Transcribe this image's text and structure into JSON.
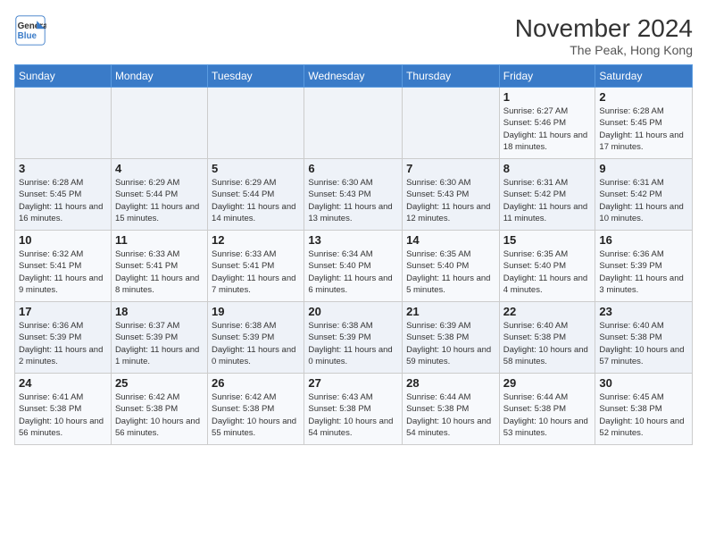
{
  "header": {
    "logo_line1": "General",
    "logo_line2": "Blue",
    "month": "November 2024",
    "location": "The Peak, Hong Kong"
  },
  "weekdays": [
    "Sunday",
    "Monday",
    "Tuesday",
    "Wednesday",
    "Thursday",
    "Friday",
    "Saturday"
  ],
  "weeks": [
    [
      {
        "day": "",
        "info": ""
      },
      {
        "day": "",
        "info": ""
      },
      {
        "day": "",
        "info": ""
      },
      {
        "day": "",
        "info": ""
      },
      {
        "day": "",
        "info": ""
      },
      {
        "day": "1",
        "info": "Sunrise: 6:27 AM\nSunset: 5:46 PM\nDaylight: 11 hours and 18 minutes."
      },
      {
        "day": "2",
        "info": "Sunrise: 6:28 AM\nSunset: 5:45 PM\nDaylight: 11 hours and 17 minutes."
      }
    ],
    [
      {
        "day": "3",
        "info": "Sunrise: 6:28 AM\nSunset: 5:45 PM\nDaylight: 11 hours and 16 minutes."
      },
      {
        "day": "4",
        "info": "Sunrise: 6:29 AM\nSunset: 5:44 PM\nDaylight: 11 hours and 15 minutes."
      },
      {
        "day": "5",
        "info": "Sunrise: 6:29 AM\nSunset: 5:44 PM\nDaylight: 11 hours and 14 minutes."
      },
      {
        "day": "6",
        "info": "Sunrise: 6:30 AM\nSunset: 5:43 PM\nDaylight: 11 hours and 13 minutes."
      },
      {
        "day": "7",
        "info": "Sunrise: 6:30 AM\nSunset: 5:43 PM\nDaylight: 11 hours and 12 minutes."
      },
      {
        "day": "8",
        "info": "Sunrise: 6:31 AM\nSunset: 5:42 PM\nDaylight: 11 hours and 11 minutes."
      },
      {
        "day": "9",
        "info": "Sunrise: 6:31 AM\nSunset: 5:42 PM\nDaylight: 11 hours and 10 minutes."
      }
    ],
    [
      {
        "day": "10",
        "info": "Sunrise: 6:32 AM\nSunset: 5:41 PM\nDaylight: 11 hours and 9 minutes."
      },
      {
        "day": "11",
        "info": "Sunrise: 6:33 AM\nSunset: 5:41 PM\nDaylight: 11 hours and 8 minutes."
      },
      {
        "day": "12",
        "info": "Sunrise: 6:33 AM\nSunset: 5:41 PM\nDaylight: 11 hours and 7 minutes."
      },
      {
        "day": "13",
        "info": "Sunrise: 6:34 AM\nSunset: 5:40 PM\nDaylight: 11 hours and 6 minutes."
      },
      {
        "day": "14",
        "info": "Sunrise: 6:35 AM\nSunset: 5:40 PM\nDaylight: 11 hours and 5 minutes."
      },
      {
        "day": "15",
        "info": "Sunrise: 6:35 AM\nSunset: 5:40 PM\nDaylight: 11 hours and 4 minutes."
      },
      {
        "day": "16",
        "info": "Sunrise: 6:36 AM\nSunset: 5:39 PM\nDaylight: 11 hours and 3 minutes."
      }
    ],
    [
      {
        "day": "17",
        "info": "Sunrise: 6:36 AM\nSunset: 5:39 PM\nDaylight: 11 hours and 2 minutes."
      },
      {
        "day": "18",
        "info": "Sunrise: 6:37 AM\nSunset: 5:39 PM\nDaylight: 11 hours and 1 minute."
      },
      {
        "day": "19",
        "info": "Sunrise: 6:38 AM\nSunset: 5:39 PM\nDaylight: 11 hours and 0 minutes."
      },
      {
        "day": "20",
        "info": "Sunrise: 6:38 AM\nSunset: 5:39 PM\nDaylight: 11 hours and 0 minutes."
      },
      {
        "day": "21",
        "info": "Sunrise: 6:39 AM\nSunset: 5:38 PM\nDaylight: 10 hours and 59 minutes."
      },
      {
        "day": "22",
        "info": "Sunrise: 6:40 AM\nSunset: 5:38 PM\nDaylight: 10 hours and 58 minutes."
      },
      {
        "day": "23",
        "info": "Sunrise: 6:40 AM\nSunset: 5:38 PM\nDaylight: 10 hours and 57 minutes."
      }
    ],
    [
      {
        "day": "24",
        "info": "Sunrise: 6:41 AM\nSunset: 5:38 PM\nDaylight: 10 hours and 56 minutes."
      },
      {
        "day": "25",
        "info": "Sunrise: 6:42 AM\nSunset: 5:38 PM\nDaylight: 10 hours and 56 minutes."
      },
      {
        "day": "26",
        "info": "Sunrise: 6:42 AM\nSunset: 5:38 PM\nDaylight: 10 hours and 55 minutes."
      },
      {
        "day": "27",
        "info": "Sunrise: 6:43 AM\nSunset: 5:38 PM\nDaylight: 10 hours and 54 minutes."
      },
      {
        "day": "28",
        "info": "Sunrise: 6:44 AM\nSunset: 5:38 PM\nDaylight: 10 hours and 54 minutes."
      },
      {
        "day": "29",
        "info": "Sunrise: 6:44 AM\nSunset: 5:38 PM\nDaylight: 10 hours and 53 minutes."
      },
      {
        "day": "30",
        "info": "Sunrise: 6:45 AM\nSunset: 5:38 PM\nDaylight: 10 hours and 52 minutes."
      }
    ]
  ]
}
